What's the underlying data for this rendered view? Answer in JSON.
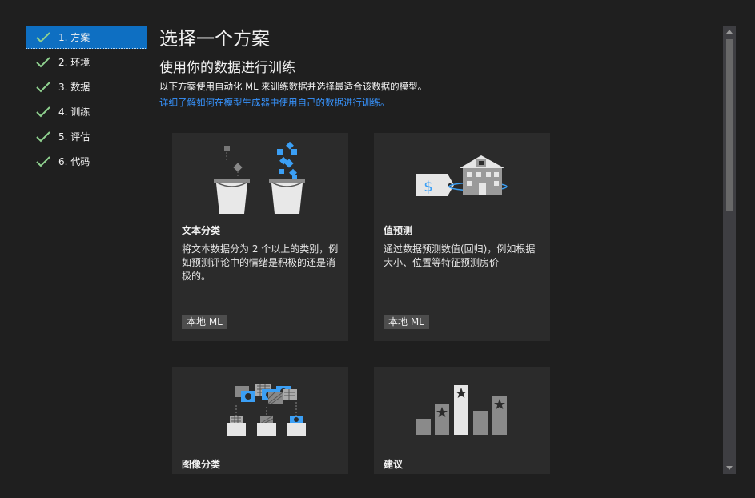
{
  "steps": [
    {
      "label": "1. 方案",
      "active": true
    },
    {
      "label": "2. 环境",
      "active": false
    },
    {
      "label": "3. 数据",
      "active": false
    },
    {
      "label": "4. 训练",
      "active": false
    },
    {
      "label": "5. 评估",
      "active": false
    },
    {
      "label": "6. 代码",
      "active": false
    }
  ],
  "header": {
    "title": "选择一个方案",
    "subtitle": "使用你的数据进行训练",
    "description": "以下方案使用自动化 ML 来训练数据并选择最适合该数据的模型。",
    "link": "详细了解如何在模型生成器中使用自己的数据进行训练。"
  },
  "cards": [
    {
      "title": "文本分类",
      "body": "将文本数据分为 2 个以上的类别，例如预测评论中的情绪是积极的还是消极的。",
      "badge": "本地 ML"
    },
    {
      "title": "值预测",
      "body": "通过数据预测数值(回归)，例如根据大小、位置等特征预测房价",
      "badge": "本地 ML"
    },
    {
      "title": "图像分类"
    },
    {
      "title": "建议"
    }
  ],
  "colors": {
    "accent": "#0e6fc2",
    "link": "#3794ff",
    "check": "#8fd18f",
    "icon_blue": "#3b9ff5"
  }
}
